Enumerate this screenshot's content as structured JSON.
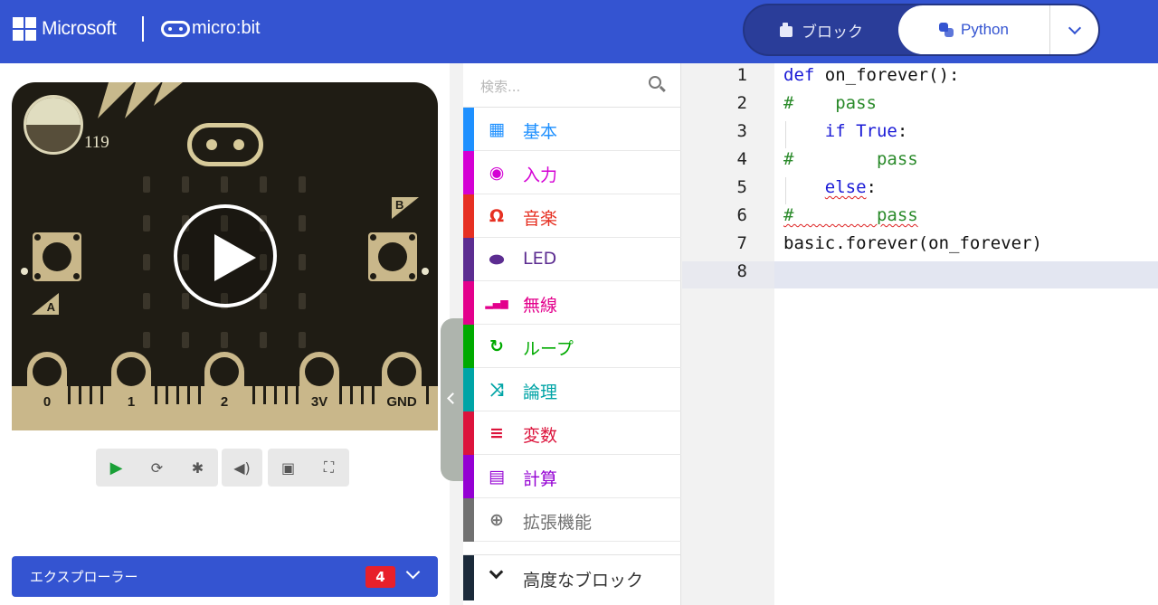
{
  "header": {
    "brand": "Microsoft",
    "product": "micro:bit",
    "mode_blocks": "ブロック",
    "mode_python": "Python",
    "accent": "#3454d1"
  },
  "simulator": {
    "light_level": "119",
    "button_a": "A",
    "button_b": "B",
    "pins": [
      "0",
      "1",
      "2",
      "3V",
      "GND"
    ],
    "toolbar": [
      "play-icon",
      "restart-icon",
      "debug-icon",
      "mute-icon",
      "screenshot-icon",
      "fullscreen-icon"
    ]
  },
  "explorer": {
    "label": "エクスプローラー",
    "badge": "4"
  },
  "toolbox": {
    "search_placeholder": "検索...",
    "categories": [
      {
        "label": "基本",
        "color": "#1e90ff",
        "icon": "grid-icon"
      },
      {
        "label": "入力",
        "color": "#d400d4",
        "icon": "circle-dot-icon"
      },
      {
        "label": "音楽",
        "color": "#e63022",
        "icon": "headphones-icon"
      },
      {
        "label": "LED",
        "color": "#5c2d91",
        "icon": "toggle-icon"
      },
      {
        "label": "無線",
        "color": "#e3008c",
        "icon": "signal-bars-icon"
      },
      {
        "label": "ループ",
        "color": "#00aa00",
        "icon": "refresh-icon"
      },
      {
        "label": "論理",
        "color": "#00a4a6",
        "icon": "shuffle-icon"
      },
      {
        "label": "変数",
        "color": "#dc143c",
        "icon": "list-icon"
      },
      {
        "label": "計算",
        "color": "#9400d3",
        "icon": "calculator-icon"
      },
      {
        "label": "拡張機能",
        "color": "#717171",
        "icon": "plus-circle-icon"
      }
    ],
    "advanced_label": "高度なブロック"
  },
  "editor": {
    "line_numbers": [
      "1",
      "2",
      "3",
      "4",
      "5",
      "6",
      "7",
      "8"
    ],
    "lines": [
      [
        {
          "t": "def",
          "c": "kw"
        },
        {
          "t": " on_forever():",
          "c": ""
        }
      ],
      [
        {
          "t": "#    pass",
          "c": "cm"
        }
      ],
      [
        {
          "t": "    ",
          "c": ""
        },
        {
          "t": "if True",
          "c": "kw"
        },
        {
          "t": ":",
          "c": ""
        }
      ],
      [
        {
          "t": "#        pass",
          "c": "cm"
        }
      ],
      [
        {
          "t": "    ",
          "c": ""
        },
        {
          "t": "else",
          "c": "kw squig"
        },
        {
          "t": ":",
          "c": ""
        }
      ],
      [
        {
          "t": "#        pass",
          "c": "cm squig"
        }
      ],
      [
        {
          "t": "basic.forever(on_forever)",
          "c": ""
        }
      ],
      [
        {
          "t": "",
          "c": ""
        }
      ]
    ]
  }
}
